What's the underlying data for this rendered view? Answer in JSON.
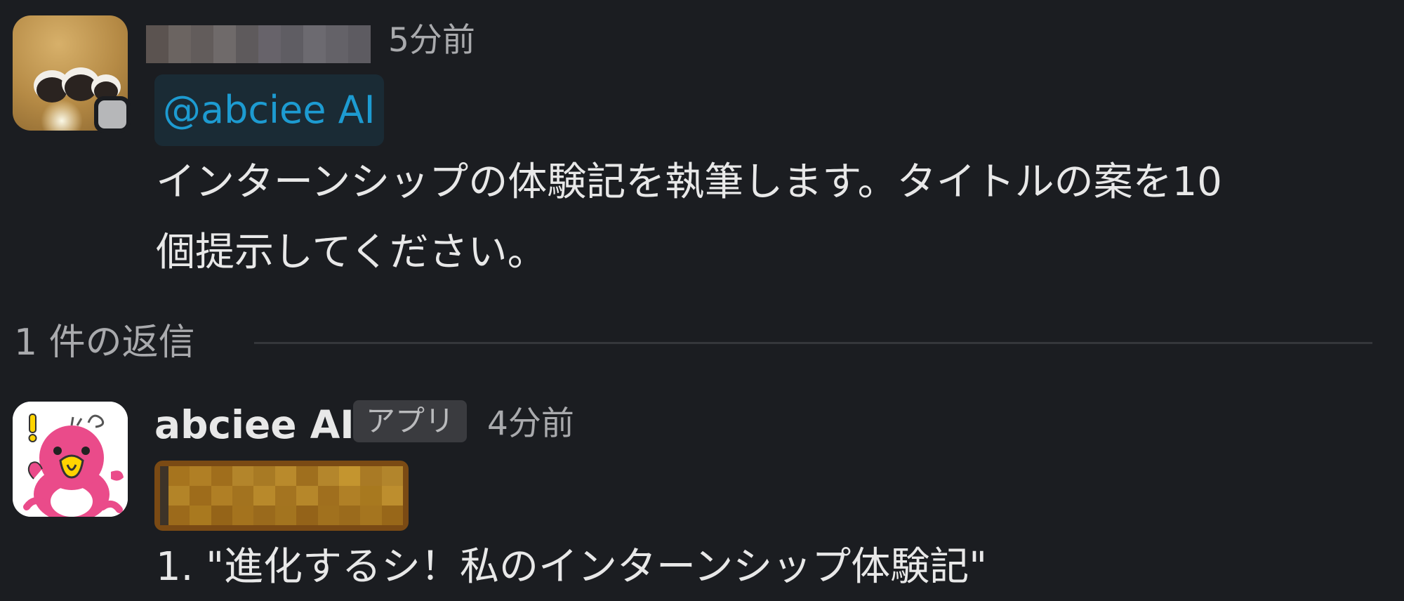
{
  "message": {
    "timestamp": "5分前",
    "mention": "@abciee AI",
    "lines": [
      "インターンシップの体験記を執筆します。タイトルの案を10",
      "個提示してください。"
    ]
  },
  "thread": {
    "replies_label": "1 件の返信"
  },
  "reply": {
    "author": "abciee AI",
    "badge": "アプリ",
    "timestamp": "4分前",
    "lines": [
      "1. \"進化するシ！私のインターンシップ体験記\""
    ]
  }
}
